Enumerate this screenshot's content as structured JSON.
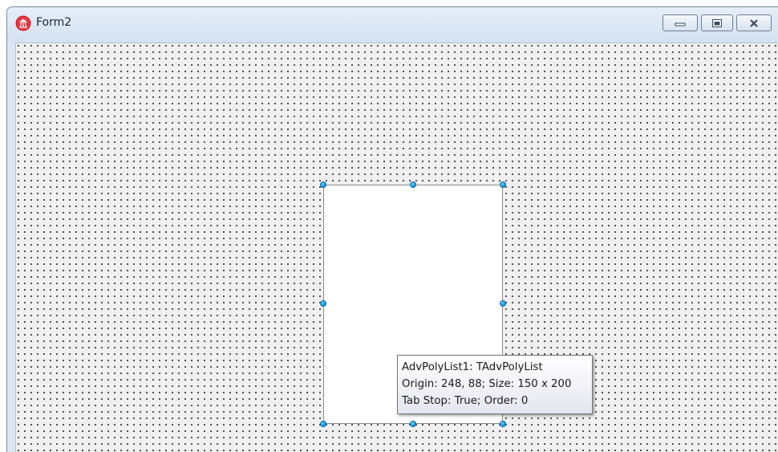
{
  "window": {
    "title": "Form2",
    "icon": "delphi-app-icon",
    "caption_buttons": [
      "minimize-icon",
      "maximize-icon",
      "close-icon"
    ]
  },
  "component": {
    "tooltip_lines": [
      "AdvPolyList1: TAdvPolyList",
      "Origin: 248, 88; Size: 150 x 200",
      "Tab Stop: True; Order: 0"
    ]
  }
}
